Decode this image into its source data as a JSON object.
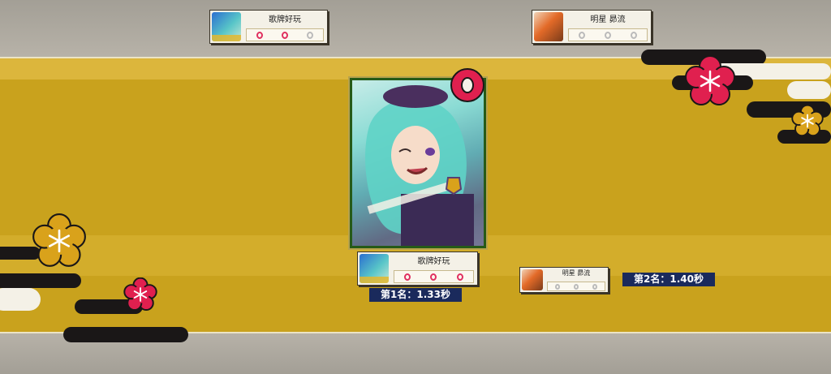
{
  "players": {
    "top_left": {
      "name": "歌牌好玩",
      "avatar": "teal-hair-avatar",
      "slots": [
        "hit",
        "hit",
        "empty"
      ]
    },
    "top_right": {
      "name": "明星 昴流",
      "avatar": "orange-hair-avatar",
      "slots": [
        "empty",
        "empty",
        "empty"
      ]
    },
    "first": {
      "name": "歌牌好玩",
      "avatar": "teal-hair-avatar",
      "slots": [
        "hit",
        "hit",
        "hit"
      ]
    },
    "second": {
      "name": "明星 昴流",
      "avatar": "orange-hair-avatar",
      "slots": [
        "empty",
        "empty",
        "empty"
      ]
    }
  },
  "results": {
    "first_label": "第1名：1.33秒",
    "second_label": "第2名：1.40秒"
  },
  "card": {
    "art": "teal-haired-character-card",
    "marker": "pink-ring-icon"
  },
  "colors": {
    "gold": "#c9a21d",
    "navy": "#1a2a5c",
    "pink": "#e03060",
    "green_frame": "#265a17"
  }
}
